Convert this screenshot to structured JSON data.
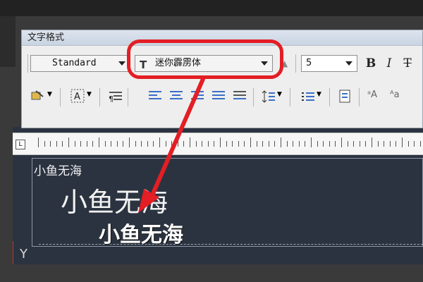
{
  "toolbar": {
    "title": "文字格式",
    "style": "Standard",
    "font": "迷你霹雳体",
    "font_icon_glyph": "T",
    "size": "5",
    "bold_label": "B",
    "italic_label": "I",
    "strike_label": "T"
  },
  "editor": {
    "line1": "小鱼无海",
    "line2": "小鱼无海",
    "line3": "小鱼无海"
  },
  "ruler": {
    "marker": "L"
  },
  "ucs": {
    "axis_label": "Y"
  },
  "colors": {
    "highlight": "#e31e24",
    "canvas": "#2b3340",
    "toolbar": "#eeeeee"
  }
}
